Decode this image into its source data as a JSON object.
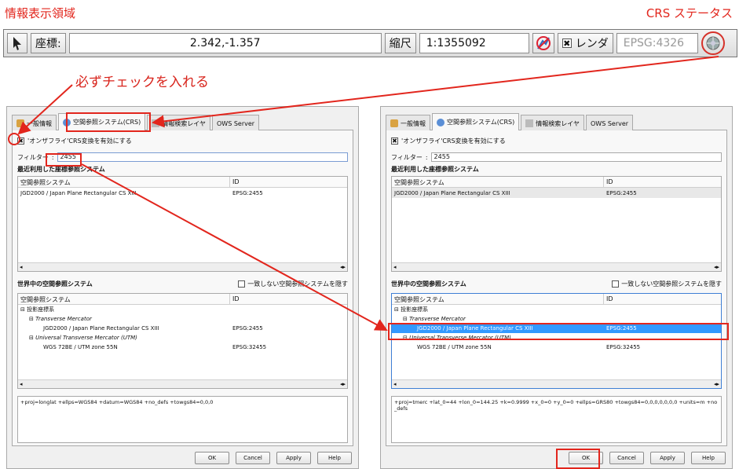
{
  "annotations": {
    "info_area": "情報表示領域",
    "crs_status": "CRS ステータス",
    "must_check": "必ずチェックを入れる"
  },
  "statusbar": {
    "coord_label": "座標:",
    "coord_value": "2.342,-1.357",
    "scale_label": "縮尺",
    "scale_value": "1:1355092",
    "render_label": "レンダ",
    "epsg": "EPSG:4326"
  },
  "left_dialog": {
    "tabs": [
      "一般情報",
      "空間参照システム(CRS)",
      "情報検索レイヤ",
      "OWS Server"
    ],
    "checkbox_label": "'オンザフライ'CRS変換を有効にする",
    "filter_label": "フィルター",
    "filter_value": "2455",
    "recent_title": "最近利用した座標参照システム",
    "recent_cols": [
      "空間参照システム",
      "ID"
    ],
    "recent_rows": [
      {
        "name": "JGD2000 / Japan Plane Rectangular CS XIII",
        "id": "EPSG:2455"
      }
    ],
    "world_title": "世界中の空間参照システム",
    "hide_label": "一致しない空間参照システムを隠す",
    "world_cols": [
      "空間参照システム",
      "ID"
    ],
    "tree": [
      {
        "label": "投影座標系",
        "id": "",
        "level": 0
      },
      {
        "label": "Transverse Mercator",
        "id": "",
        "level": 1
      },
      {
        "label": "JGD2000 / Japan Plane Rectangular CS XIII",
        "id": "EPSG:2455",
        "level": 2
      },
      {
        "label": "Universal Transverse Mercator (UTM)",
        "id": "",
        "level": 1
      },
      {
        "label": "WGS 72BE / UTM zone 55N",
        "id": "EPSG:32455",
        "level": 2
      }
    ],
    "proj_params": "+proj=longlat +ellps=WGS84 +datum=WGS84 +no_defs +towgs84=0,0,0",
    "buttons": [
      "OK",
      "Cancel",
      "Apply",
      "Help"
    ]
  },
  "right_dialog": {
    "tabs": [
      "一般情報",
      "空間参照システム(CRS)",
      "情報検索レイヤ",
      "OWS Server"
    ],
    "checkbox_label": "'オンザフライ'CRS変換を有効にする",
    "filter_label": "フィルター",
    "filter_value": "2455",
    "recent_title": "最近利用した座標参照システム",
    "recent_cols": [
      "空間参照システム",
      "ID"
    ],
    "recent_rows": [
      {
        "name": "JGD2000 / Japan Plane Rectangular CS XIII",
        "id": "EPSG:2455"
      }
    ],
    "world_title": "世界中の空間参照システム",
    "hide_label": "一致しない空間参照システムを隠す",
    "world_cols": [
      "空間参照システム",
      "ID"
    ],
    "tree": [
      {
        "label": "投影座標系",
        "id": "",
        "level": 0
      },
      {
        "label": "Transverse Mercator",
        "id": "",
        "level": 1
      },
      {
        "label": "JGD2000 / Japan Plane Rectangular CS XIII",
        "id": "EPSG:2455",
        "level": 2,
        "selected": true
      },
      {
        "label": "Universal Transverse Mercator (UTM)",
        "id": "",
        "level": 1
      },
      {
        "label": "WGS 72BE / UTM zone 55N",
        "id": "EPSG:32455",
        "level": 2
      }
    ],
    "proj_params": "+proj=tmerc +lat_0=44 +lon_0=144.25 +k=0.9999 +x_0=0 +y_0=0 +ellps=GRS80 +towgs84=0,0,0,0,0,0,0 +units=m +no_defs",
    "buttons": [
      "OK",
      "Cancel",
      "Apply",
      "Help"
    ]
  },
  "colors": {
    "annotation_red": "#e2261d",
    "selection_blue": "#3399ff"
  }
}
